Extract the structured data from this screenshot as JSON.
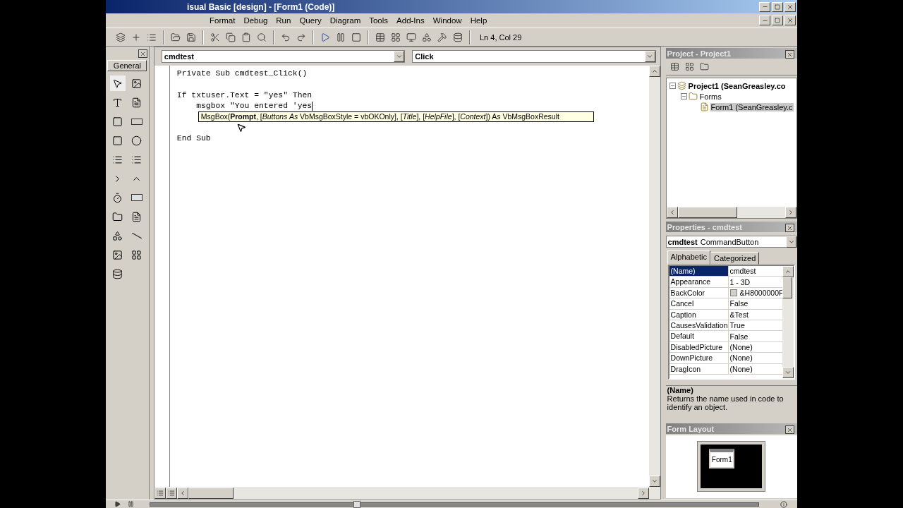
{
  "window": {
    "title": "isual Basic [design] - [Form1 (Code)]"
  },
  "menu": [
    "Format",
    "Debug",
    "Run",
    "Query",
    "Diagram",
    "Tools",
    "Add-Ins",
    "Window",
    "Help"
  ],
  "toolbar": {
    "position": "Ln 4, Col 29"
  },
  "toolbox": {
    "tab": "General"
  },
  "code_window": {
    "object": "cmdtest",
    "procedure": "Click",
    "blocks": [
      [
        {
          "text": "Private Sub cmdtest_Click()",
          "caret": false
        }
      ],
      [
        {
          "text": "If txtuser.Text = \"yes\" Then",
          "caret": false
        },
        {
          "text": "    msgbox \"You entered 'yes",
          "caret": true
        }
      ],
      [
        {
          "text": "End Sub",
          "caret": false
        }
      ]
    ],
    "tooltip": "MsgBox(**Prompt**, [*Buttons As* VbMsgBoxStyle = vbOKOnly], [*Title*], [*HelpFile*], [*Context*]) As VbMsgBoxResult"
  },
  "project": {
    "title": "Project - Project1",
    "tree": [
      {
        "label": "Project1 (SeanGreasley.co",
        "kind": "project",
        "expanded": true,
        "selected": false,
        "children": [
          {
            "label": "Forms",
            "kind": "folder",
            "expanded": true,
            "selected": false,
            "children": [
              {
                "label": "Form1 (SeanGreasley.c",
                "kind": "form",
                "selected": true
              }
            ]
          }
        ]
      }
    ]
  },
  "properties": {
    "title": "Properties - cmdtest",
    "object": "cmdtest",
    "object_type": "CommandButton",
    "tabs": [
      {
        "label": "Alphabetic",
        "selected": true
      },
      {
        "label": "Categorized",
        "selected": false
      }
    ],
    "rows": [
      {
        "name": "(Name)",
        "value": "cmdtest",
        "kind": "text",
        "selected": true
      },
      {
        "name": "Appearance",
        "value": "1 - 3D",
        "kind": "text",
        "selected": false
      },
      {
        "name": "BackColor",
        "value": "&H8000000F",
        "kind": "color",
        "selected": false
      },
      {
        "name": "Cancel",
        "value": "False",
        "kind": "text",
        "selected": false
      },
      {
        "name": "Caption",
        "value": "&Test",
        "kind": "text",
        "selected": false
      },
      {
        "name": "CausesValidation",
        "value": "True",
        "kind": "text",
        "selected": false
      },
      {
        "name": "Default",
        "value": "False",
        "kind": "text",
        "selected": false
      },
      {
        "name": "DisabledPicture",
        "value": "(None)",
        "kind": "text",
        "selected": false
      },
      {
        "name": "DownPicture",
        "value": "(None)",
        "kind": "text",
        "selected": false
      },
      {
        "name": "DragIcon",
        "value": "(None)",
        "kind": "text",
        "selected": false
      }
    ],
    "description_title": "(Name)",
    "description": "Returns the name used in code to identify an object."
  },
  "form_layout": {
    "title": "Form Layout",
    "form": "Form1"
  },
  "player": {
    "level": 0.34
  }
}
